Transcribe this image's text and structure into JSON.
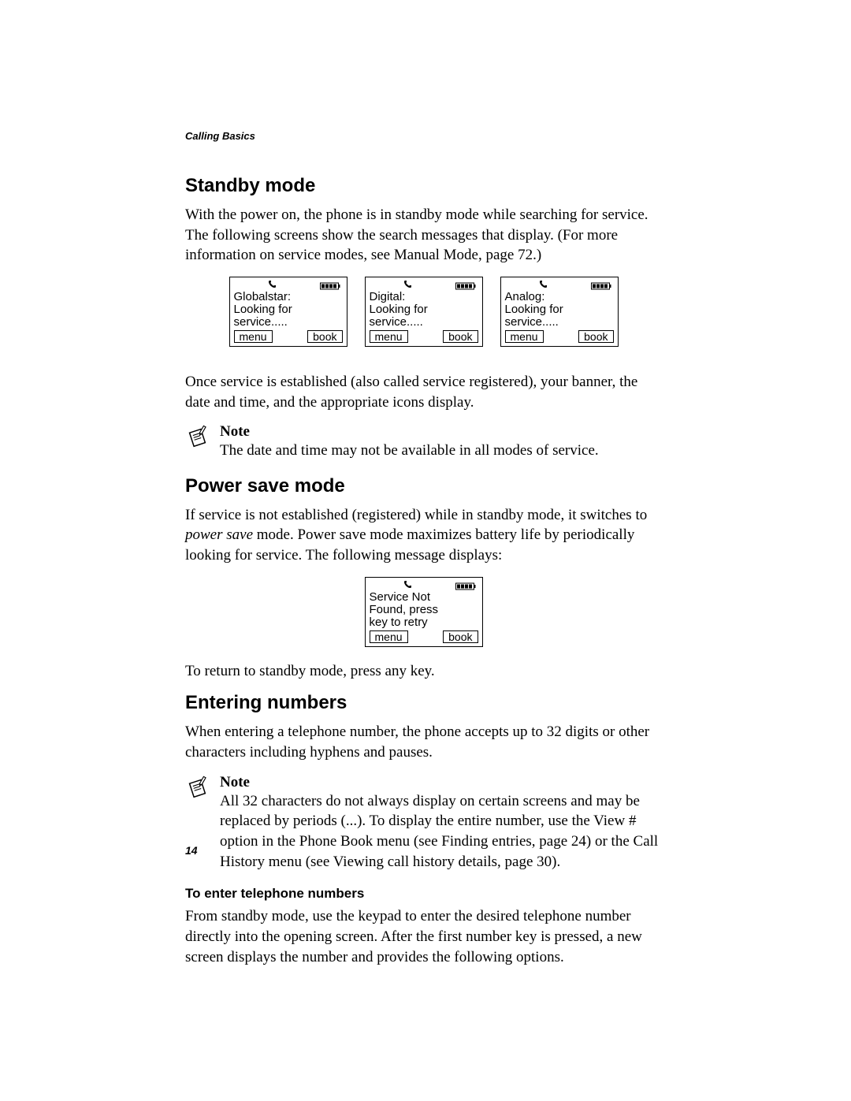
{
  "header": "Calling Basics",
  "page_number": "14",
  "sec1": {
    "title": "Standby mode",
    "p1": "With the power on, the phone is in standby mode while searching for service. The following screens show the search messages that display. (For more information on service modes, see Manual Mode, page 72.)",
    "p2": "Once service is established (also called service registered), your banner, the date and time, and the appropriate icons display."
  },
  "screens_row1": [
    {
      "line1": "Globalstar:",
      "line2": "Looking for",
      "line3": "service.....",
      "left_key": "menu",
      "right_key": "book"
    },
    {
      "line1": "Digital:",
      "line2": "Looking for",
      "line3": "service.....",
      "left_key": "menu",
      "right_key": "book"
    },
    {
      "line1": "Analog:",
      "line2": "Looking for",
      "line3": "service.....",
      "left_key": "menu",
      "right_key": "book"
    }
  ],
  "note1": {
    "label": "Note",
    "text": "The date and time may not be available in all modes of service."
  },
  "sec2": {
    "title": "Power save mode",
    "p1_before_em": "If service is not established (registered) while in standby mode, it switches to ",
    "p1_em": "power save",
    "p1_after_em": " mode. Power save mode maximizes battery life by periodically looking for service. The following message displays:",
    "p2": "To return to standby mode, press any key."
  },
  "screen_single": {
    "line1": "Service Not",
    "line2": "Found, press",
    "line3": "key to retry",
    "left_key": "menu",
    "right_key": "book"
  },
  "sec3": {
    "title": "Entering numbers",
    "p1": "When entering a telephone number, the phone accepts up to 32 digits or other characters including hyphens and pauses."
  },
  "note2": {
    "label": "Note",
    "text": "All 32 characters do not always display on certain screens and may be replaced by periods (...). To display the entire number, use the View # option in the Phone Book menu (see Finding entries, page 24) or the Call History menu (see Viewing call history details, page 30)."
  },
  "sub1": {
    "title": "To enter telephone numbers",
    "p1": "From standby mode, use the keypad to enter the desired telephone number directly into the opening screen. After the first number key is pressed, a new screen displays the number and provides the following options."
  }
}
